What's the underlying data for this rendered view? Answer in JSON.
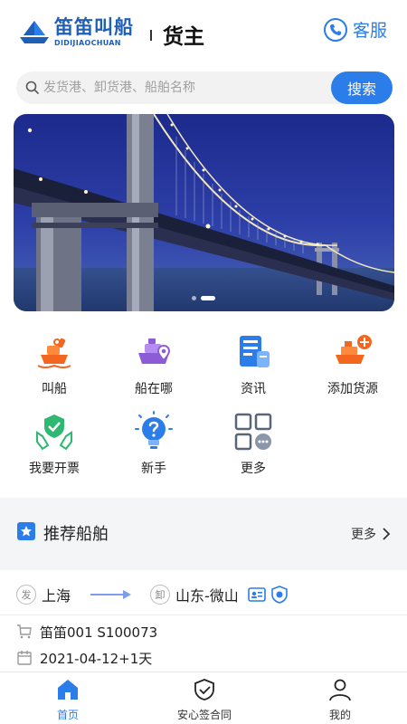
{
  "header": {
    "logo_cn": "笛笛叫船",
    "logo_en": "DIDIJIAOCHUAN",
    "role": "货主",
    "service_label": "客服"
  },
  "search": {
    "placeholder": "发货港、卸货港、船舶名称",
    "button_label": "搜索"
  },
  "banner": {
    "slides": 2,
    "active_slide": 2
  },
  "quick_actions": [
    {
      "label": "叫船",
      "icon": "ship-call-icon"
    },
    {
      "label": "船在哪",
      "icon": "ship-location-icon"
    },
    {
      "label": "资讯",
      "icon": "news-icon"
    },
    {
      "label": "添加货源",
      "icon": "add-cargo-icon"
    },
    {
      "label": "我要开票",
      "icon": "invoice-icon"
    },
    {
      "label": "新手",
      "icon": "help-icon"
    },
    {
      "label": "更多",
      "icon": "more-grid-icon"
    }
  ],
  "recommended": {
    "title": "推荐船舶",
    "more_label": "更多",
    "ship": {
      "from_badge": "发",
      "from": "上海",
      "to_badge": "卸",
      "to": "山东-微山",
      "name": "笛笛001 S100073",
      "date": "2021-04-12+1天"
    }
  },
  "tabbar": [
    {
      "label": "首页",
      "active": true
    },
    {
      "label": "安心签合同",
      "active": false
    },
    {
      "label": "我的",
      "active": false
    }
  ],
  "colors": {
    "accent": "#2b7de9",
    "orange": "#f2661f",
    "purple": "#8e5bd6",
    "green": "#2eb872"
  }
}
